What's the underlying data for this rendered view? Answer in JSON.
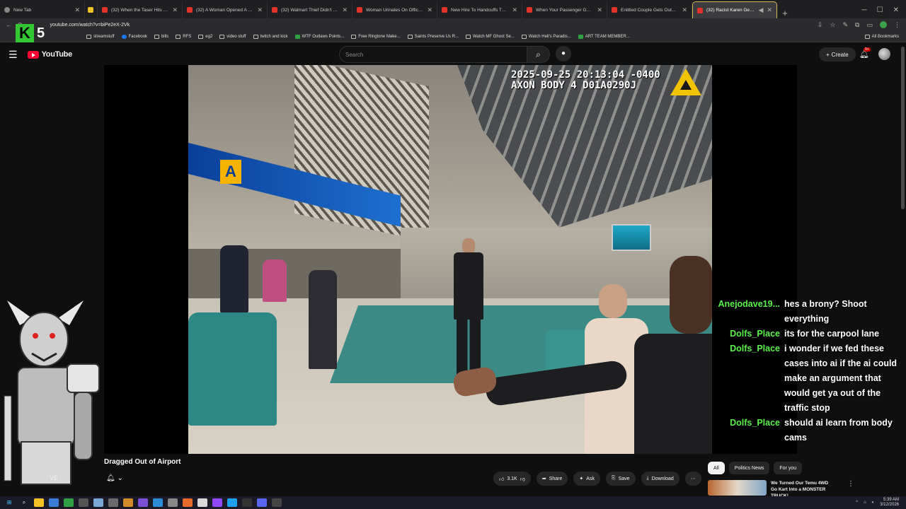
{
  "browser": {
    "tabs": [
      {
        "title": "New Tab",
        "active": false
      },
      {
        "title": "",
        "active": false
      },
      {
        "title": "(32) When the Taser Hits - Susp",
        "active": false
      },
      {
        "title": "(32) A Woman Opened A Cop'",
        "active": false
      },
      {
        "title": "(32) Walmart Thief Didn't Kno",
        "active": false
      },
      {
        "title": "Woman Urinates On Officers W",
        "active": false
      },
      {
        "title": "New Hire To Handcuffs The Sh",
        "active": false
      },
      {
        "title": "When Your Passenger Gets Tim",
        "active": false
      },
      {
        "title": "Entitled Couple Gets Outsmart",
        "active": false
      },
      {
        "title": "(32) Racist Karen Get Drag",
        "active": true
      }
    ],
    "new_tab_glyph": "+",
    "url": "youtube.com/watch?v=biPe2eX-2Vk",
    "bookmarks": [
      "streamstuff",
      "Facebook",
      "bills",
      "RFS",
      "eg2",
      "video stuff",
      "twitch and kick",
      "WTF Outlaws Points...",
      "Free Ringtone Make...",
      "Saints Preserve Us R...",
      "Watch MF Ghost Se...",
      "Watch Hell's Paradis...",
      "ART TEAM MEMBER..."
    ],
    "all_bookmarks": "All Bookmarks"
  },
  "overlay": {
    "badge_letter": "K",
    "badge_number": "5"
  },
  "youtube": {
    "logo_text": "YouTube",
    "search_placeholder": "Search",
    "create_label": "Create",
    "notifications_badge": "9+",
    "video_timestamp_line1": "2025-09-25 20:13:04 -0400",
    "video_timestamp_line2": "AXON BODY 4 D01A0290J",
    "video_title": "Dragged Out of Airport",
    "channel_fragment": "VE",
    "subs_fragment": "Subscribed",
    "actions": {
      "likes": "3.1K",
      "share": "Share",
      "ask": "Ask",
      "save": "Save",
      "download": "Download"
    },
    "chips": [
      "All",
      "Politics News",
      "For you"
    ],
    "recommendation_title": "We Turned Our Temu 4WD Go Kart Into a MONSTER TRUCK!"
  },
  "chat": [
    {
      "user": "Anejodave19...",
      "text": "hes a brony? Shoot everything"
    },
    {
      "user": "Dolfs_Place",
      "text": "its for the carpool lane"
    },
    {
      "user": "Dolfs_Place",
      "text": "i wonder if we fed these cases into ai if the ai could make an argument that would get ya out of the traffic stop"
    },
    {
      "user": "Dolfs_Place",
      "text": "should ai learn from body cams"
    }
  ],
  "taskbar": {
    "time": "5:39 AM",
    "date": "3/12/2026"
  },
  "colors": {
    "chat_user": "#5bf04b",
    "yt_red": "#ff0033",
    "active_tab_border": "#d4b85a"
  }
}
